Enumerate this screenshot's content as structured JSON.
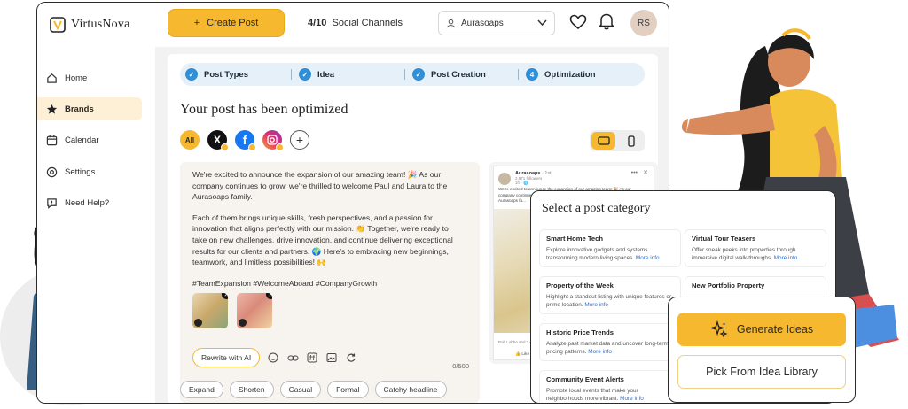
{
  "brand": {
    "name": "VirtusNova"
  },
  "header": {
    "create_post_label": "Create Post",
    "channels_count": "4/10",
    "channels_label": "Social Channels",
    "account_name": "Aurasoaps",
    "avatar_initials": "RS"
  },
  "sidebar": {
    "items": [
      {
        "label": "Home",
        "icon": "home-icon"
      },
      {
        "label": "Brands",
        "icon": "star-icon",
        "active": true
      },
      {
        "label": "Calendar",
        "icon": "calendar-icon"
      },
      {
        "label": "Settings",
        "icon": "gear-icon"
      },
      {
        "label": "Need Help?",
        "icon": "help-icon"
      }
    ]
  },
  "stepper": {
    "steps": [
      {
        "label": "Post Types",
        "state": "done"
      },
      {
        "label": "Idea",
        "state": "done"
      },
      {
        "label": "Post Creation",
        "state": "done"
      },
      {
        "label": "Optimization",
        "number": "4",
        "state": "current"
      }
    ]
  },
  "main": {
    "title": "Your post has been optimized",
    "channel_all_label": "All",
    "post_text_p1": "We're excited to announce the expansion of our amazing team! 🎉 As our company continues to grow, we're thrilled to welcome Paul and Laura to the Aurasoaps family.",
    "post_text_p2": "Each of them brings unique skills, fresh perspectives, and a passion for innovation that aligns perfectly with our mission. 👏 Together, we're ready to take on new challenges, drive innovation, and continue delivering exceptional results for our clients and partners. 🌍 Here's to embracing new beginnings, teamwork, and limitless possibilities! 🙌",
    "post_hashtags": "#TeamExpansion #WelcomeAboard #CompanyGrowth",
    "rewrite_label": "Rewrite with AI",
    "char_counter": "0/500",
    "quick_actions": [
      "Expand",
      "Shorten",
      "Casual",
      "Formal",
      "Catchy headline"
    ]
  },
  "preview": {
    "account_name": "Aurasoaps",
    "time": "· 1st",
    "followers": "2,871 followers",
    "age": "1h · 🌐",
    "text": "We're excited to announce the expansion of our amazing team! 🎉 As our company continues to grow, we're thrilled to welcome Paul and Laura to the Aurasoaps fa...",
    "reactions": "Bob Lobba and 2 others",
    "like_label": "Like"
  },
  "category_modal": {
    "title": "Select a post category",
    "more_label": "More info",
    "categories": [
      {
        "title": "Smart Home Tech",
        "desc": "Explore innovative gadgets and systems transforming modern living spaces."
      },
      {
        "title": "Virtual Tour Teasers",
        "desc": "Offer sneak peeks into properties through immersive digital walk-throughs."
      },
      {
        "title": "Property of the Week",
        "desc": "Highlight a standout listing with unique features or prime location."
      },
      {
        "title": "New Portfolio Property",
        "desc": ""
      },
      {
        "title": "Historic Price Trends",
        "desc": "Analyze past market data and uncover long-term pricing patterns."
      },
      {
        "title": "Community Event Alerts",
        "desc": "Promote local events that make your neighborhoods more vibrant."
      }
    ]
  },
  "ideas_card": {
    "generate_label": "Generate Ideas",
    "library_label": "Pick From Idea Library"
  },
  "colors": {
    "accent": "#f5b82e",
    "step_blue": "#2f8fd8",
    "panel_bg": "#f2f2f2"
  }
}
